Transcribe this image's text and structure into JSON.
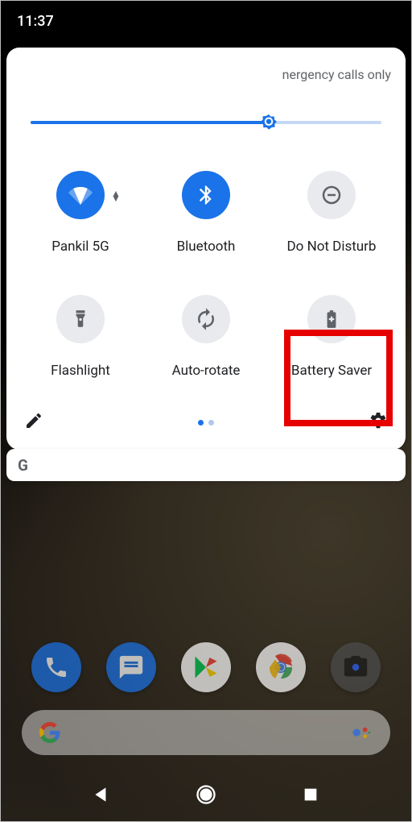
{
  "status": {
    "time": "11:37"
  },
  "qs": {
    "network_status": "nergency calls only",
    "brightness_pct": 68,
    "tiles": [
      {
        "label": "Pankil 5G",
        "active": true,
        "icon": "wifi",
        "expandable": true
      },
      {
        "label": "Bluetooth",
        "active": true,
        "icon": "bluetooth",
        "expandable": false
      },
      {
        "label": "Do Not Disturb",
        "active": false,
        "icon": "dnd",
        "expandable": false
      },
      {
        "label": "Flashlight",
        "active": false,
        "icon": "flashlight",
        "expandable": false
      },
      {
        "label": "Auto-rotate",
        "active": false,
        "icon": "rotate",
        "expandable": false
      },
      {
        "label": "Battery Saver",
        "active": false,
        "icon": "battery",
        "expandable": false
      }
    ],
    "page_count": 2,
    "page_index": 0,
    "highlighted_tile": 5
  },
  "notification": {
    "app_icon": "G"
  },
  "dock": [
    {
      "name": "phone",
      "bg": "#1a73e8"
    },
    {
      "name": "messages",
      "bg": "#1a73e8"
    },
    {
      "name": "play",
      "bg": "#ffffff"
    },
    {
      "name": "chrome",
      "bg": "#ffffff"
    },
    {
      "name": "camera",
      "bg": "#4d4d4d"
    }
  ]
}
